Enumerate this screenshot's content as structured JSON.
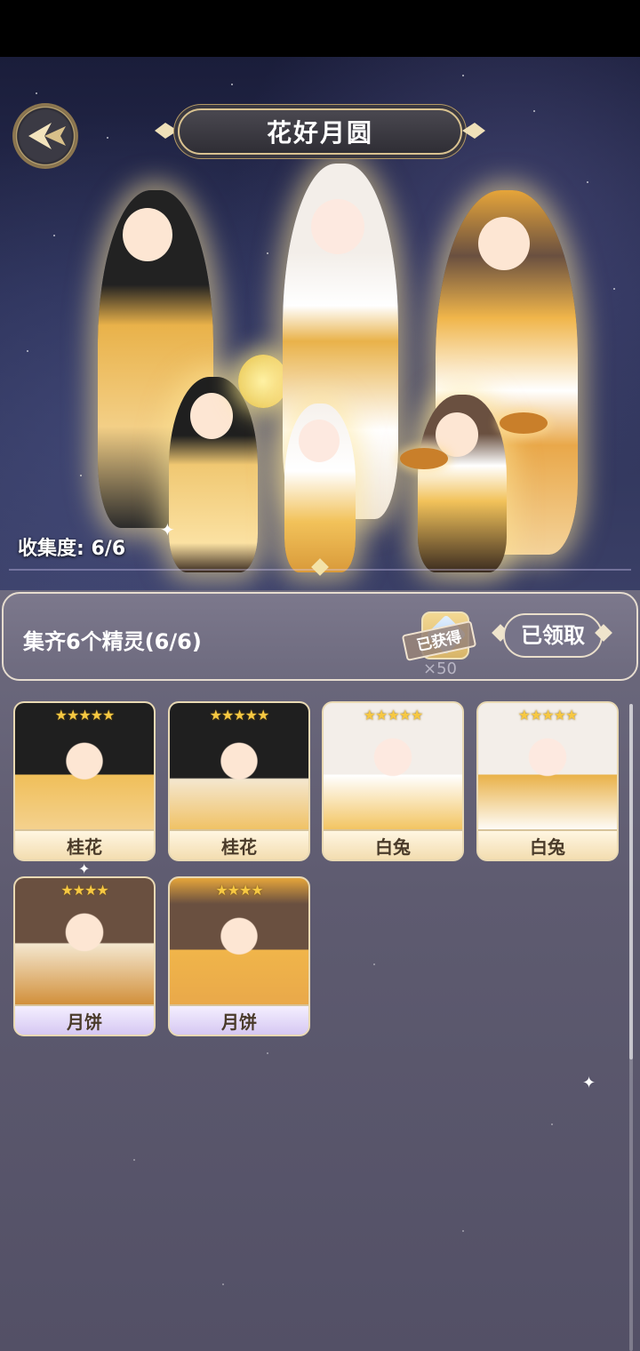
{
  "header": {
    "title": "花好月圆",
    "collection_label": "收集度:",
    "collection_value": "6/6"
  },
  "reward": {
    "title": "集齐6个精灵(6/6)",
    "stamp": "已获得",
    "quantity": "×50",
    "button_label": "已领取"
  },
  "cards": [
    {
      "name": "桂花",
      "stars": "★★★★★",
      "rarity": "gold"
    },
    {
      "name": "桂花",
      "stars": "★★★★★",
      "rarity": "gold"
    },
    {
      "name": "白兔",
      "stars": "★★★★★",
      "rarity": "gold"
    },
    {
      "name": "白兔",
      "stars": "★★★★★",
      "rarity": "gold"
    },
    {
      "name": "月饼",
      "stars": "★★★★",
      "rarity": "purple"
    },
    {
      "name": "月饼",
      "stars": "★★★★",
      "rarity": "purple"
    }
  ],
  "icons": {
    "back": "chevron-left-icon",
    "reward": "crystal-icon"
  },
  "colors": {
    "accent_gold": "#d9c290",
    "star": "#f7c842",
    "panel": "#6d6a7e"
  }
}
